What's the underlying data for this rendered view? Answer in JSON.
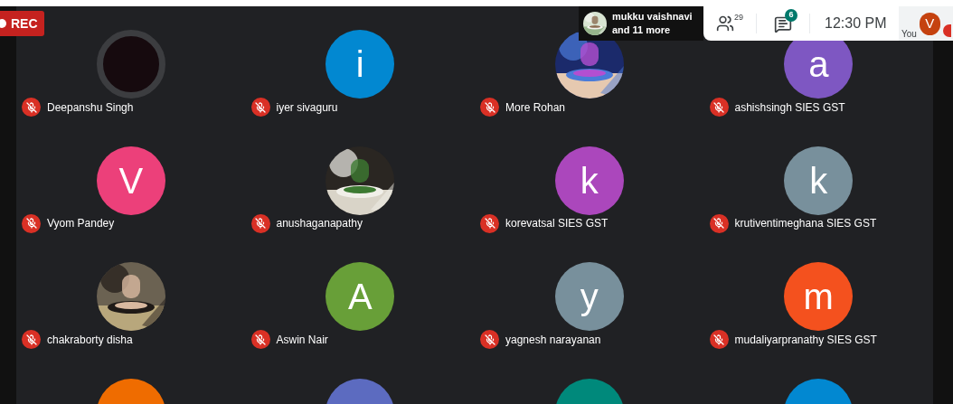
{
  "recording_badge": {
    "label": "REC"
  },
  "top_bar": {
    "presenter": {
      "name": "mukku vaishnavi",
      "others": "and 11 more"
    },
    "people_count": "29",
    "chat_badge": "6",
    "time": "12:30 PM",
    "self": {
      "label": "You",
      "initial": "V",
      "color": "#c5420f"
    }
  },
  "participants": [
    {
      "name": "Deepanshu Singh",
      "muted": true,
      "avatar": {
        "kind": "blank"
      }
    },
    {
      "name": "iyer sivaguru",
      "muted": true,
      "avatar": {
        "kind": "letter",
        "letter": "i",
        "color": "#0288d1"
      }
    },
    {
      "name": "More Rohan",
      "muted": true
    },
    {
      "name": "ashishsingh SIES GST",
      "muted": true,
      "avatar": {
        "kind": "letter",
        "letter": "a",
        "color": "#7e57c2"
      }
    },
    {
      "name": "Vyom Pandey",
      "muted": true,
      "avatar": {
        "kind": "letter",
        "letter": "V",
        "color": "#ec407a"
      }
    },
    {
      "name": "anushaganapathy",
      "muted": true
    },
    {
      "name": "korevatsal SIES GST",
      "muted": true,
      "avatar": {
        "kind": "letter",
        "letter": "k",
        "color": "#ab47bc"
      }
    },
    {
      "name": "krutiventimeghana SIES GST",
      "muted": true,
      "avatar": {
        "kind": "letter",
        "letter": "k",
        "color": "#78909c"
      }
    },
    {
      "name": "chakraborty disha",
      "muted": true
    },
    {
      "name": "Aswin Nair",
      "muted": true,
      "avatar": {
        "kind": "letter",
        "letter": "A",
        "color": "#689f38"
      }
    },
    {
      "name": "yagnesh narayanan",
      "muted": true,
      "avatar": {
        "kind": "letter",
        "letter": "y",
        "color": "#78909c"
      }
    },
    {
      "name": "mudaliyarpranathy SIES GST",
      "muted": true,
      "avatar": {
        "kind": "letter",
        "letter": "m",
        "color": "#f4511e"
      }
    },
    {
      "avatar": {
        "kind": "letter",
        "color": "#ef6c00"
      }
    },
    {
      "avatar": {
        "kind": "letter",
        "color": "#5c6bc0"
      }
    },
    {
      "avatar": {
        "kind": "letter",
        "color": "#00897b"
      }
    },
    {
      "avatar": {
        "kind": "letter",
        "color": "#0288d1"
      }
    }
  ]
}
